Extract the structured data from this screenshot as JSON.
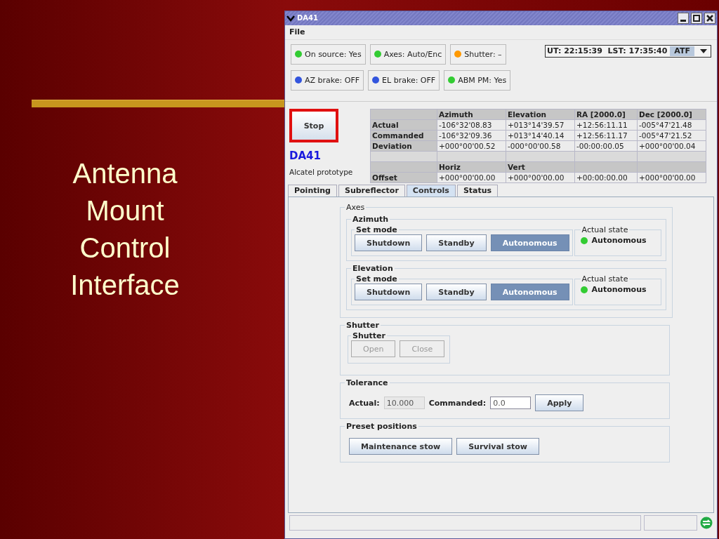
{
  "slide": {
    "title": "Antenna Mount Control Interface"
  },
  "window": {
    "title": "DA41"
  },
  "menu": [
    "File"
  ],
  "indicators": [
    {
      "label": "On source: Yes",
      "color": "#33cc33"
    },
    {
      "label": "Axes: Auto/Enc",
      "color": "#33cc33"
    },
    {
      "label": "Shutter: –",
      "color": "#ff9900"
    },
    {
      "label": "AZ brake: OFF",
      "color": "#3355dd"
    },
    {
      "label": "EL brake: OFF",
      "color": "#3355dd"
    },
    {
      "label": "ABM PM: Yes",
      "color": "#33cc33"
    }
  ],
  "clock": {
    "text": "UT: 22:15:39  LST: 17:35:40",
    "mode": "ATF"
  },
  "stop_button": "Stop",
  "antenna": {
    "name": "DA41",
    "description": "Alcatel prototype"
  },
  "table": {
    "rows": [
      {
        "kind": "header",
        "cells": [
          "Azimuth",
          "Elevation",
          "RA [2000.0]",
          "Dec [2000.0]"
        ]
      },
      {
        "kind": "data",
        "label": "Actual",
        "cells": [
          "-106°32'08.83",
          "+013°14'39.57",
          "+12:56:11.11",
          "-005°47'21.48"
        ]
      },
      {
        "kind": "data",
        "label": "Commanded",
        "cells": [
          "-106°32'09.36",
          "+013°14'40.14",
          "+12:56:11.17",
          "-005°47'21.52"
        ]
      },
      {
        "kind": "data",
        "label": "Deviation",
        "cells": [
          "+000°00'00.52",
          "-000°00'00.58",
          "-00:00:00.05",
          "+000°00'00.04"
        ]
      },
      {
        "kind": "blank"
      },
      {
        "kind": "header",
        "cells": [
          "Horiz",
          "Vert"
        ]
      },
      {
        "kind": "data",
        "label": "Offset",
        "cells": [
          "+000°00'00.00",
          "+000°00'00.00",
          "+00:00:00.00",
          "+000°00'00.00"
        ]
      }
    ]
  },
  "tabs": [
    {
      "label": "Pointing",
      "selected": false
    },
    {
      "label": "Subreflector",
      "selected": false
    },
    {
      "label": "Controls",
      "selected": true
    },
    {
      "label": "Status",
      "selected": false
    }
  ],
  "axes": {
    "title": "Axes",
    "groups": [
      {
        "title": "Azimuth",
        "set_mode_title": "Set mode",
        "buttons": [
          {
            "label": "Shutdown",
            "selected": false
          },
          {
            "label": "Standby",
            "selected": false
          },
          {
            "label": "Autonomous",
            "selected": true
          }
        ],
        "state_title": "Actual state",
        "state": {
          "label": "Autonomous",
          "color": "#33cc33"
        }
      },
      {
        "title": "Elevation",
        "set_mode_title": "Set mode",
        "buttons": [
          {
            "label": "Shutdown",
            "selected": false
          },
          {
            "label": "Standby",
            "selected": false
          },
          {
            "label": "Autonomous",
            "selected": true
          }
        ],
        "state_title": "Actual state",
        "state": {
          "label": "Autonomous",
          "color": "#33cc33"
        }
      }
    ]
  },
  "shutter": {
    "title": "Shutter",
    "inner_title": "Shutter",
    "buttons": [
      {
        "label": "Open",
        "disabled": true
      },
      {
        "label": "Close",
        "disabled": true
      }
    ]
  },
  "tolerance": {
    "title": "Tolerance",
    "actual_label": "Actual:",
    "actual_value": "10.000",
    "commanded_label": "Commanded:",
    "commanded_value": "0.0",
    "apply": "Apply"
  },
  "presets": {
    "title": "Preset positions",
    "buttons": [
      "Maintenance stow",
      "Survival stow"
    ]
  }
}
